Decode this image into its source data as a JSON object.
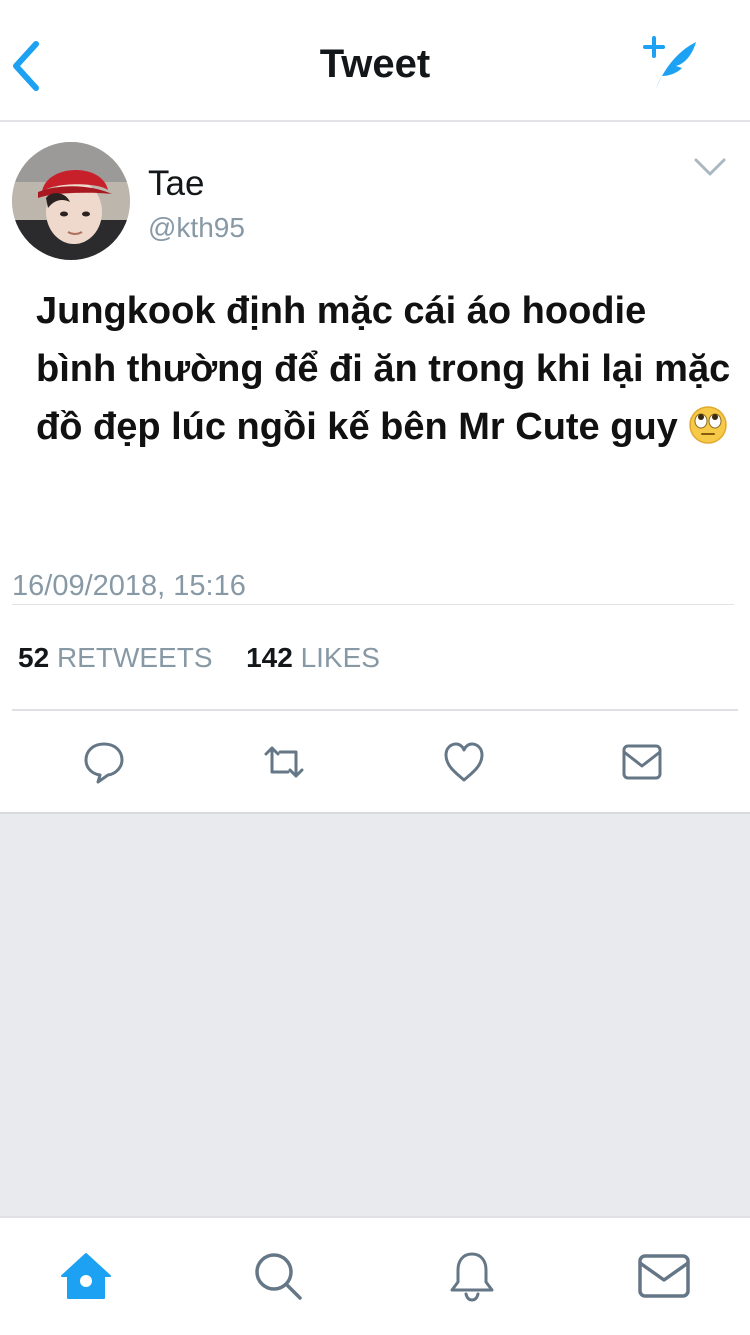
{
  "header": {
    "title": "Tweet",
    "back_icon": "chevron-left-icon",
    "compose_icon": "compose-tweet-icon"
  },
  "tweet": {
    "author_name": "Tae",
    "author_handle": "@kth95",
    "text": "Jungkook định mặc cái áo hoodie bình thường để đi ăn trong khi lại mặc đồ đẹp lúc ngồi kế bên Mr Cute guy",
    "emoji": "🙄",
    "timestamp": "16/09/2018, 15:16",
    "retweets_count": "52",
    "retweets_label": "RETWEETS",
    "likes_count": "142",
    "likes_label": "LIKES"
  },
  "actions": [
    {
      "icon": "reply-icon"
    },
    {
      "icon": "retweet-icon"
    },
    {
      "icon": "like-icon"
    },
    {
      "icon": "message-icon"
    }
  ],
  "tabbar": [
    {
      "icon": "home-icon",
      "active": true
    },
    {
      "icon": "search-icon"
    },
    {
      "icon": "notifications-icon"
    },
    {
      "icon": "messages-icon"
    }
  ],
  "colors": {
    "accent": "#1da1f2",
    "icon_gray": "#657786",
    "muted_text": "#8899a6",
    "background": "#e9eaee"
  }
}
